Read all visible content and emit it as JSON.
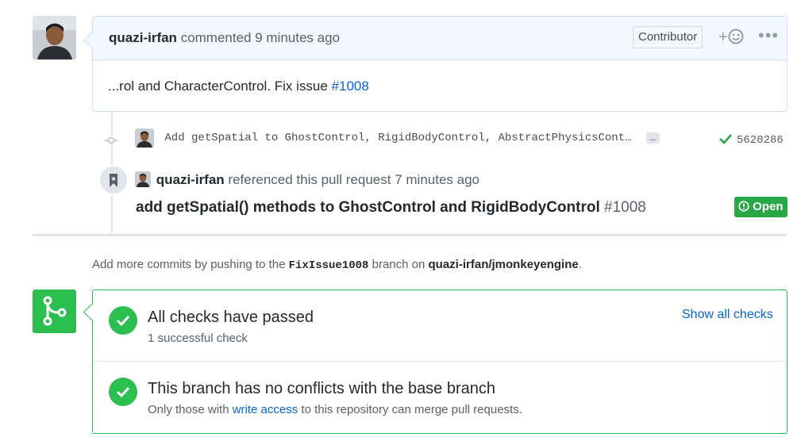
{
  "comment": {
    "author": "quazi-irfan",
    "action": "commented 9 minutes ago",
    "badge": "Contributor",
    "reaction_plus": "+",
    "more": "•••",
    "body_text": "...rol and CharacterControl. Fix issue ",
    "body_link": "#1008"
  },
  "commit": {
    "message": "Add getSpatial to GhostControl, RigidBodyControl, AbstractPhysicsCont…",
    "ellipsis": "…",
    "sha": "5620286"
  },
  "reference": {
    "author": "quazi-irfan",
    "action": "referenced this pull request 7 minutes ago",
    "title": "add getSpatial() methods to GhostControl and RigidBodyControl",
    "number": "#1008",
    "status": "Open"
  },
  "push_note": {
    "prefix": "Add more commits by pushing to the ",
    "branch": "FixIssue1008",
    "middle": " branch on ",
    "repo": "quazi-irfan/jmonkeyengine",
    "suffix": "."
  },
  "checks": {
    "title": "All checks have passed",
    "subtitle": "1 successful check",
    "show_all": "Show all checks"
  },
  "conflicts": {
    "title": "This branch has no conflicts with the base branch",
    "sub_prefix": "Only those with ",
    "sub_link": "write access",
    "sub_suffix": " to this repository can merge pull requests."
  },
  "colors": {
    "success": "#2cbe4e",
    "link": "#0366d6",
    "header_bg": "#f1f8ff"
  },
  "icons": [
    "avatar",
    "smiley-icon",
    "kebab-icon",
    "commit-icon",
    "check-icon",
    "bookmark-icon",
    "issue-opened-icon",
    "git-merge-icon",
    "check-circle-icon"
  ]
}
